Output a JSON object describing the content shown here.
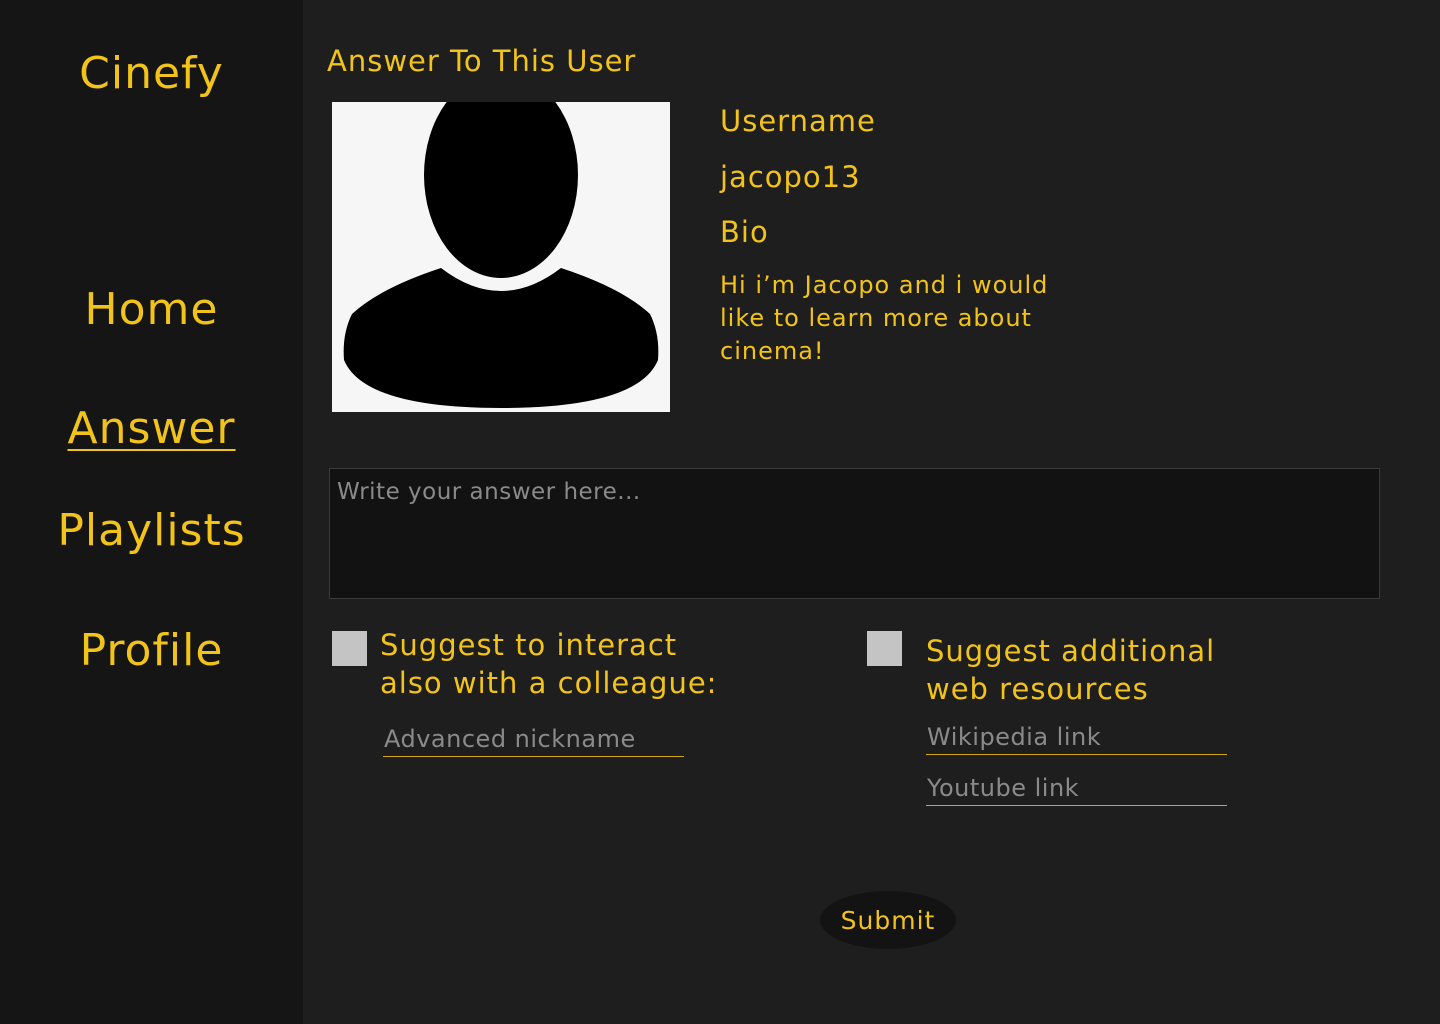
{
  "app": {
    "name": "Cinefy"
  },
  "nav": {
    "items": [
      {
        "label": "Home"
      },
      {
        "label": "Answer"
      },
      {
        "label": "Playlists"
      },
      {
        "label": "Profile"
      }
    ]
  },
  "main": {
    "title": "Answer To This User",
    "avatar": {
      "icon": "user-silhouette-icon"
    },
    "user": {
      "username_label": "Username",
      "username": "jacopo13",
      "bio_label": "Bio",
      "bio": "Hi i’m Jacopo and i would like to learn more about cinema!"
    },
    "answer": {
      "placeholder": "Write your answer here..."
    },
    "colleague": {
      "label": "Suggest to interact also with a colleague:",
      "nickname_placeholder": "Advanced nickname"
    },
    "resources": {
      "label": "Suggest additional web resources",
      "wikipedia_placeholder": "Wikipedia link",
      "youtube_placeholder": "Youtube link"
    },
    "submit_label": "Submit"
  },
  "colors": {
    "accent": "#f2c318",
    "sidebar_bg": "#151515",
    "main_bg": "#1e1e1e"
  }
}
